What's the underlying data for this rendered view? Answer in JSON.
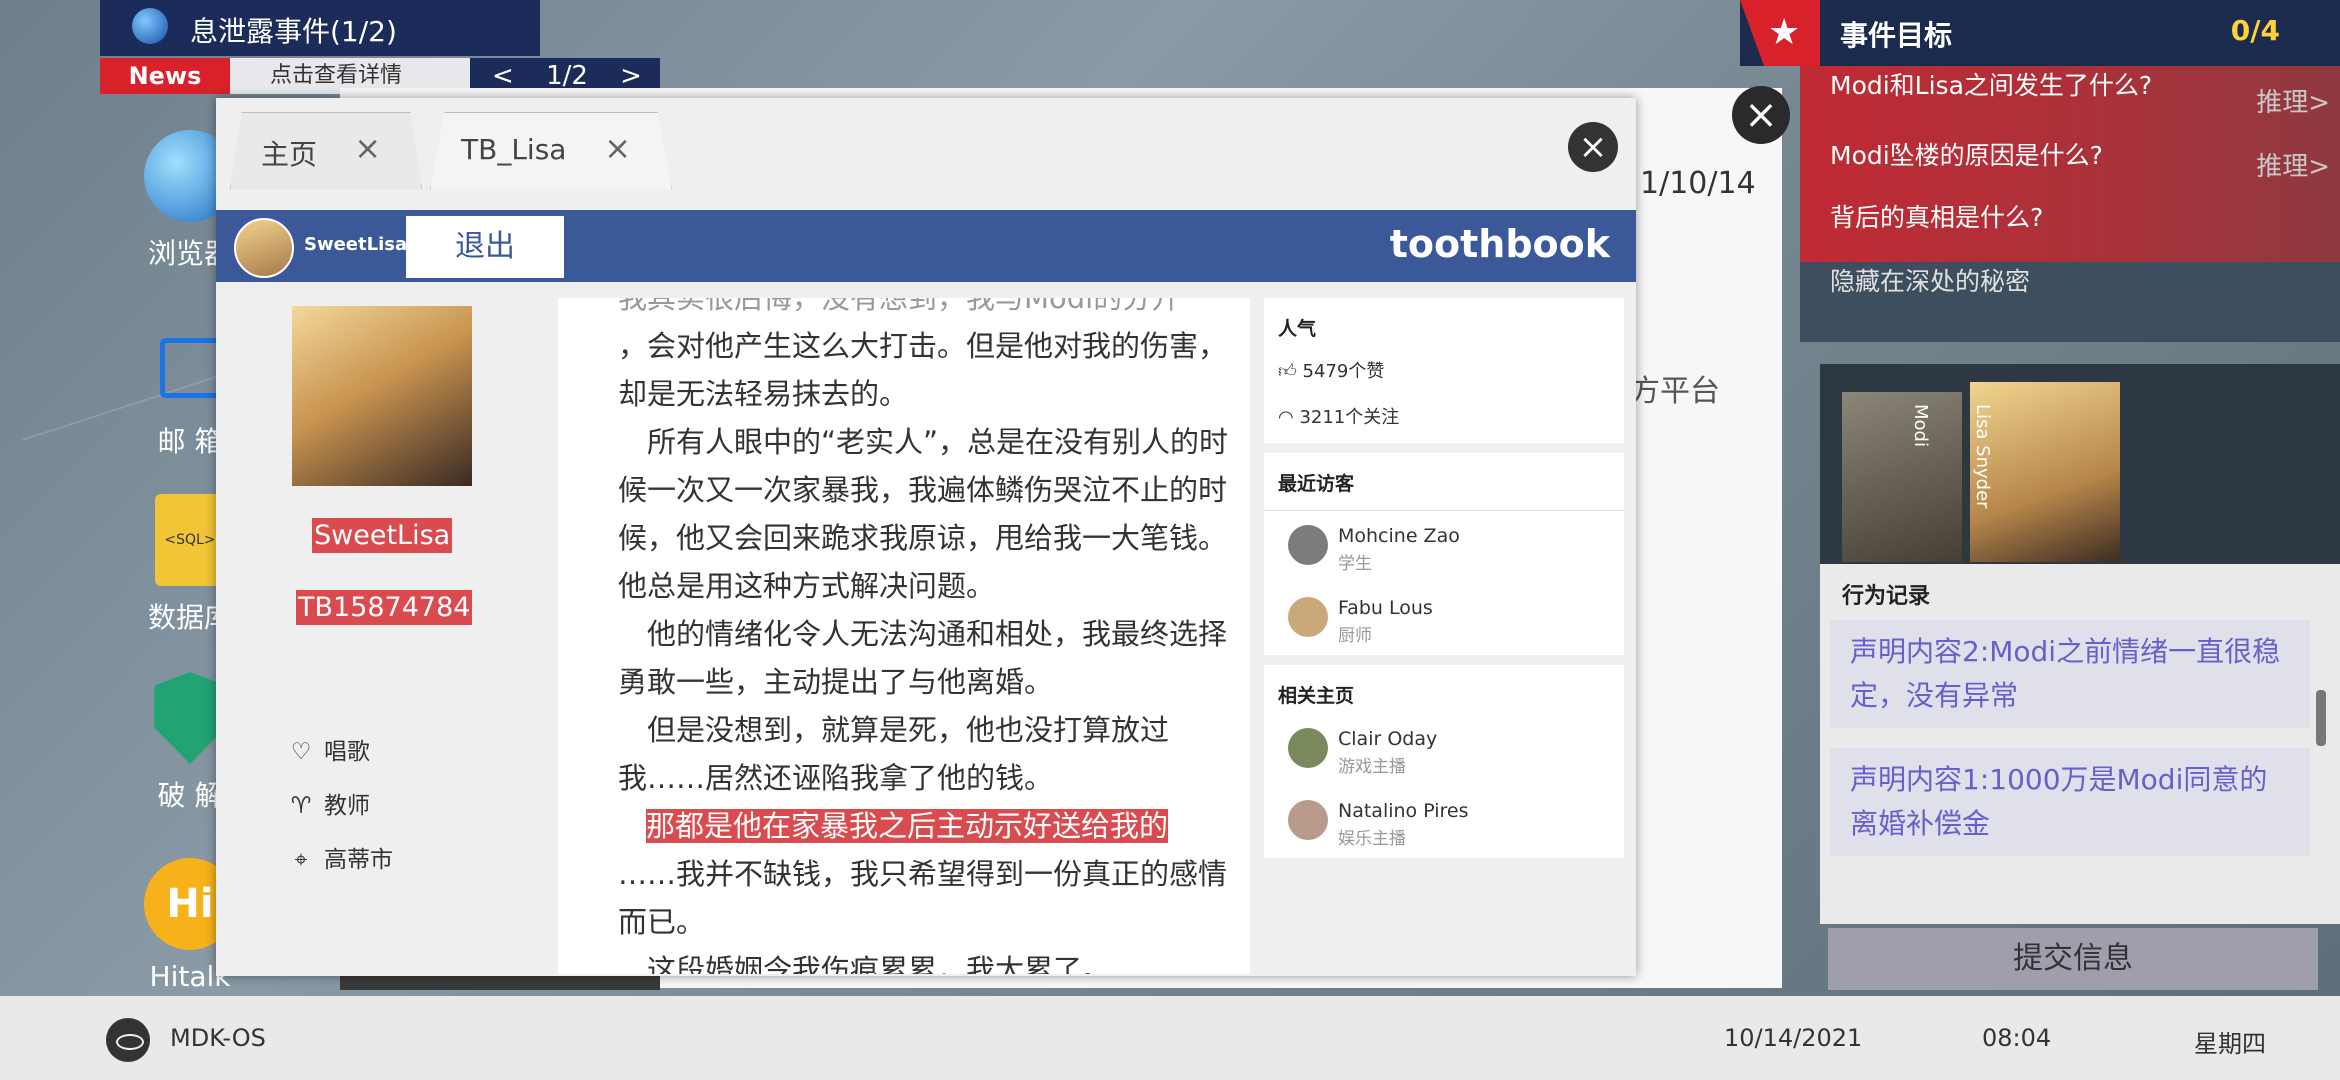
{
  "news": {
    "title": "息泄露事件(1/2)",
    "tag": "News",
    "subtitle": "点击查看详情",
    "page": "1/2",
    "prev": "<",
    "next": ">"
  },
  "desktop": {
    "browser": "浏览器",
    "mail": "邮 箱",
    "database": "数据库",
    "crack": "破 解",
    "hitalk": "Hitalk",
    "sql_badge": "<SQL>",
    "hitalk_badge": "Hi"
  },
  "objectives": {
    "title": "事件目标",
    "count": "0/4",
    "items": [
      {
        "text": "Modi和Lisa之间发生了什么?",
        "action": "推理>"
      },
      {
        "text": "Modi坠楼的原因是什么?",
        "action": "推理>"
      },
      {
        "text": "背后的真相是什么?",
        "action": ""
      }
    ],
    "hidden": "隐藏在深处的秘密"
  },
  "suspects": {
    "left_label": "Modi",
    "right_label": "Lisa Snyder"
  },
  "records": {
    "title": "行为记录",
    "items": [
      "声明内容2:Modi之前情绪一直很稳定，没有异常",
      "声明内容1:1000万是Modi同意的离婚补偿金"
    ],
    "submit": "提交信息"
  },
  "back_window": {
    "date": "1/10/14",
    "platform": "方平台",
    "close": "×"
  },
  "browser": {
    "tabs": [
      {
        "label": "主页",
        "close": "×"
      },
      {
        "label": "TB_Lisa",
        "close": "×"
      }
    ],
    "close": "×"
  },
  "toothbook": {
    "user": "SweetLisa",
    "logout": "退出",
    "logo": "toothbook"
  },
  "profile": {
    "name": "SweetLisa",
    "id": "TB15874784",
    "hobby": "唱歌",
    "job": "教师",
    "city": "高蒂市"
  },
  "post": {
    "lines": [
      "我其实很后悔，没有想到，我与Modi的分开",
      "，会对他产生这么大打击。但是他对我的伤害，却是无法轻易抹去的。",
      "　所有人眼中的“老实人”，总是在没有别人的时候一次又一次家暴我，我遍体鳞伤哭泣不止的时候，他又会回来跪求我原谅，甩给我一大笔钱。他总是用这种方式解决问题。",
      "　他的情绪化令人无法沟通和相处，我最终选择勇敢一些，主动提出了与他离婚。",
      "　但是没想到，就算是死，他也没打算放过我……居然还诬陷我拿了他的钱。"
    ],
    "highlight": "那都是他在家暴我之后主动示好送给我的",
    "after": "……我并不缺钱，我只希望得到一份真正的感情而已。",
    "last": "　这段婚姻令我伤痕累累，我太累了。"
  },
  "sidebar": {
    "popularity_title": "人气",
    "likes": "5479个赞",
    "follows": "3211个关注",
    "visitors_title": "最近访客",
    "visitors": [
      {
        "name": "Mohcine Zao",
        "role": "学生"
      },
      {
        "name": "Fabu Lous",
        "role": "厨师"
      }
    ],
    "related_title": "相关主页",
    "related": [
      {
        "name": "Clair Oday",
        "role": "游戏主播"
      },
      {
        "name": "Natalino Pires",
        "role": "娱乐主播"
      }
    ]
  },
  "taskbar": {
    "os": "MDK-OS",
    "date": "10/14/2021",
    "time": "08:04",
    "weekday": "星期四"
  }
}
